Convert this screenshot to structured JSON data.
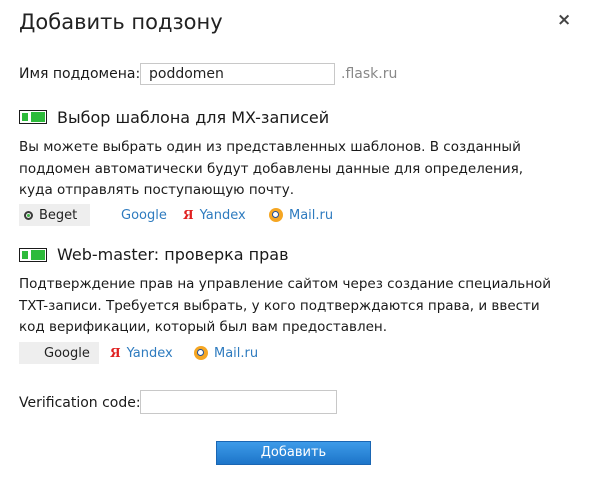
{
  "dialog": {
    "title": "Добавить подзону",
    "close_label": "×"
  },
  "subdomain": {
    "label": "Имя поддомена:",
    "value": "poddomen",
    "suffix": ".flask.ru"
  },
  "mx": {
    "title": "Выбор шаблона для MX-записей",
    "enabled": true,
    "description": "Вы можете выбрать один из представленных шаблонов. В созданный поддомен автоматически будут добавлены данные для определения, куда отправлять поступающую почту.",
    "options": [
      {
        "label": "Beget",
        "icon": "beget-icon",
        "selected": true
      },
      {
        "label": "Google",
        "icon": "google-icon",
        "selected": false
      },
      {
        "label": "Yandex",
        "icon": "yandex-icon",
        "selected": false
      },
      {
        "label": "Mail.ru",
        "icon": "mailru-icon",
        "selected": false
      }
    ]
  },
  "webmaster": {
    "title": "Web-master: проверка прав",
    "enabled": true,
    "description": "Подтверждение прав на управление сайтом через создание специальной TXT-записи. Требуется выбрать, у кого подтверждаются права, и ввести код верификации, который был вам предоставлен.",
    "options": [
      {
        "label": "Google",
        "icon": "google-icon",
        "selected": true
      },
      {
        "label": "Yandex",
        "icon": "yandex-icon",
        "selected": false
      },
      {
        "label": "Mail.ru",
        "icon": "mailru-icon",
        "selected": false
      }
    ]
  },
  "verification": {
    "label": "Verification code:",
    "value": ""
  },
  "submit": {
    "label": "Добавить"
  },
  "colors": {
    "toggle_on": "#2dbb3b",
    "link": "#2e7bbf",
    "button": "#1d75c9"
  }
}
